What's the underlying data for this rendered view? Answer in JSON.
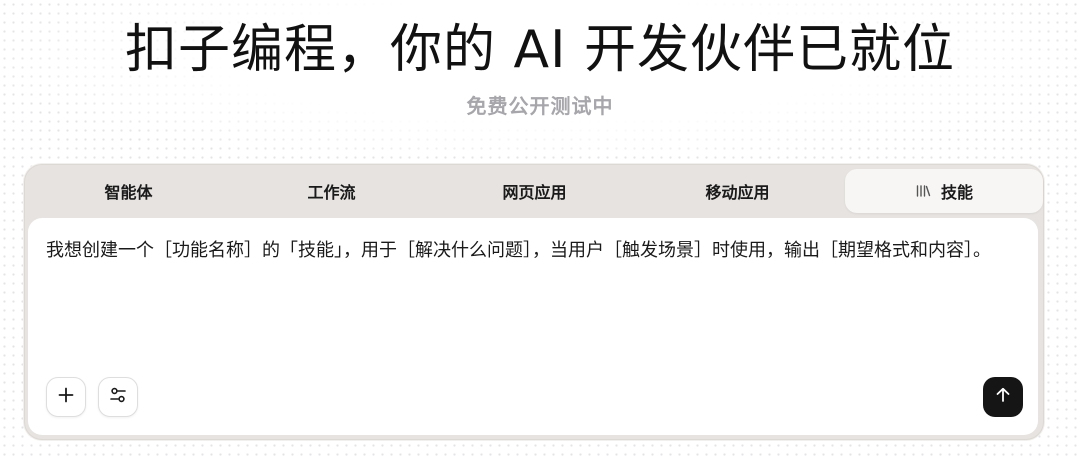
{
  "hero": {
    "title": "扣子编程，你的 AI 开发伙伴已就位",
    "subtitle": "免费公开测试中"
  },
  "tabs": [
    {
      "label": "智能体",
      "active": false
    },
    {
      "label": "工作流",
      "active": false
    },
    {
      "label": "网页应用",
      "active": false
    },
    {
      "label": "移动应用",
      "active": false
    },
    {
      "label": "技能",
      "active": true,
      "icon": "library-icon"
    }
  ],
  "editor": {
    "prompt": "我想创建一个［功能名称］的「技能」，用于［解决什么问题］，当用户［触发场景］时使用，输出［期望格式和内容］。"
  },
  "actions": {
    "add_icon": "plus-icon",
    "settings_icon": "sliders-icon",
    "send_icon": "arrow-up-icon"
  },
  "colors": {
    "panel": "#e6e3e0",
    "active_tab": "#f7f6f5",
    "send_button": "#151515",
    "subtitle": "#a6a6ab"
  }
}
